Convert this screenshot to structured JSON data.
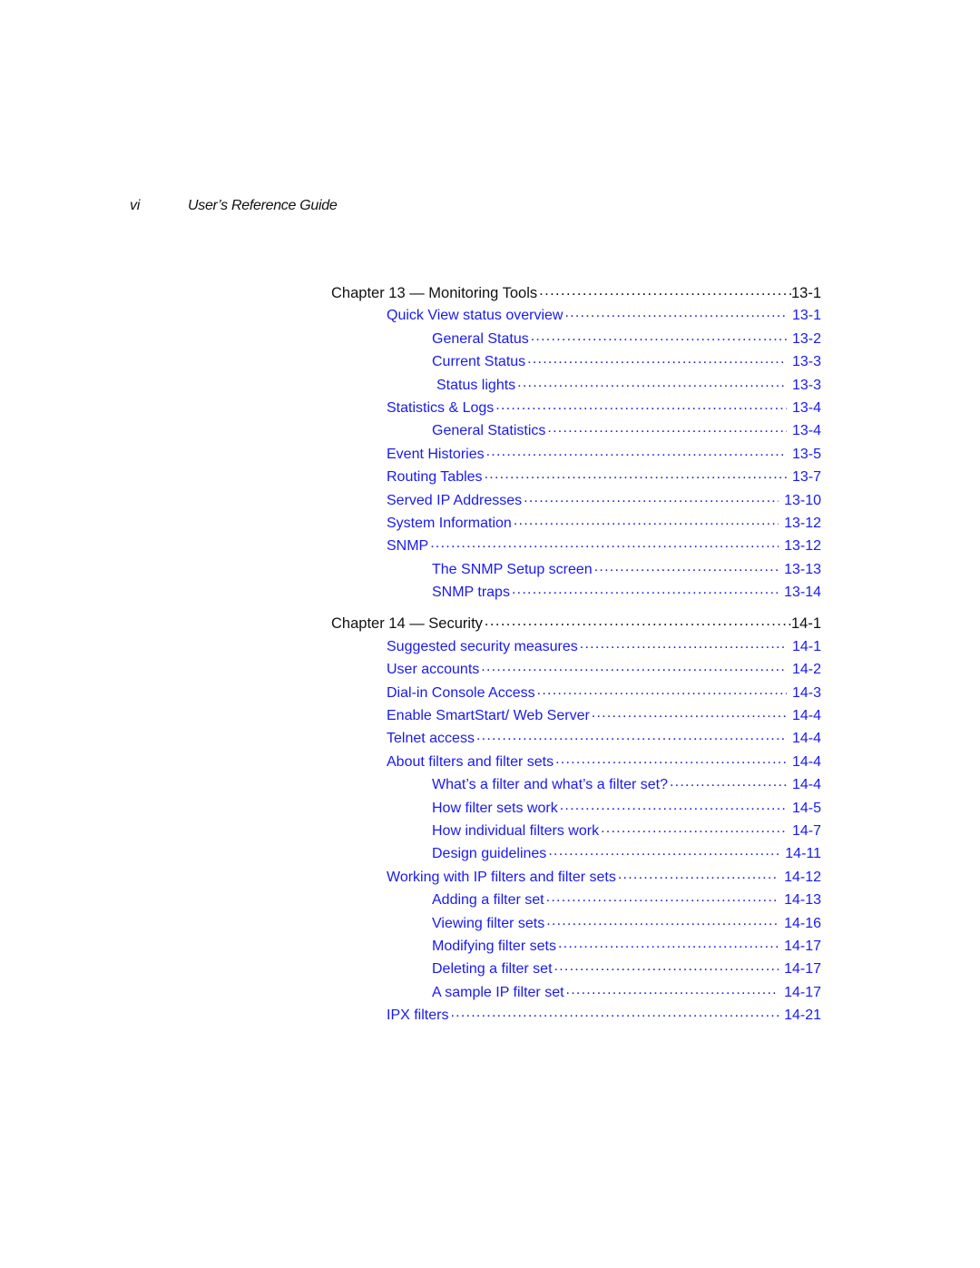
{
  "running_head": {
    "page_number": "vi",
    "title": "User’s Reference Guide"
  },
  "colors": {
    "link": "#1a1aee",
    "text": "#111111"
  },
  "toc": {
    "chapter13": {
      "title": "Chapter 13 — Monitoring Tools",
      "page": "13-1",
      "entries": [
        {
          "title": "Quick View status overview",
          "page": "13-1",
          "level": 1
        },
        {
          "title": "General Status",
          "page": "13-2",
          "level": 2
        },
        {
          "title": "Current Status",
          "page": "13-3",
          "level": 2
        },
        {
          "title": "Status lights",
          "page": "13-3",
          "level": 3
        },
        {
          "title": "Statistics & Logs",
          "page": "13-4",
          "level": 1
        },
        {
          "title": "General Statistics",
          "page": "13-4",
          "level": 2
        },
        {
          "title": "Event Histories",
          "page": "13-5",
          "level": 1
        },
        {
          "title": "Routing Tables",
          "page": "13-7",
          "level": 1
        },
        {
          "title": "Served IP Addresses",
          "page": "13-10",
          "level": 1
        },
        {
          "title": "System Information",
          "page": "13-12",
          "level": 1
        },
        {
          "title": "SNMP",
          "page": "13-12",
          "level": 1
        },
        {
          "title": "The SNMP Setup screen",
          "page": "13-13",
          "level": 2
        },
        {
          "title": "SNMP traps",
          "page": "13-14",
          "level": 2
        }
      ]
    },
    "chapter14": {
      "title": "Chapter 14 — Security",
      "page": "14-1",
      "entries": [
        {
          "title": "Suggested security measures",
          "page": "14-1",
          "level": 1
        },
        {
          "title": "User accounts",
          "page": "14-2",
          "level": 1
        },
        {
          "title": "Dial-in Console Access",
          "page": "14-3",
          "level": 1
        },
        {
          "title": "Enable SmartStart/ Web Server",
          "page": "14-4",
          "level": 1
        },
        {
          "title": "Telnet access",
          "page": "14-4",
          "level": 1
        },
        {
          "title": "About filters and filter sets",
          "page": "14-4",
          "level": 1
        },
        {
          "title": "What’s a filter and what’s a filter set?",
          "page": "14-4",
          "level": 2
        },
        {
          "title": "How filter sets work",
          "page": "14-5",
          "level": 2
        },
        {
          "title": "How individual filters work",
          "page": "14-7",
          "level": 2
        },
        {
          "title": "Design guidelines",
          "page": "14-11",
          "level": 2
        },
        {
          "title": "Working with IP filters and filter sets",
          "page": "14-12",
          "level": 1
        },
        {
          "title": "Adding a filter set",
          "page": "14-13",
          "level": 2
        },
        {
          "title": "Viewing filter sets",
          "page": "14-16",
          "level": 2
        },
        {
          "title": "Modifying filter sets",
          "page": "14-17",
          "level": 2
        },
        {
          "title": "Deleting a filter set",
          "page": "14-17",
          "level": 2
        },
        {
          "title": "A sample IP filter set",
          "page": "14-17",
          "level": 2
        },
        {
          "title": "IPX filters",
          "page": "14-21",
          "level": 1
        }
      ]
    }
  }
}
